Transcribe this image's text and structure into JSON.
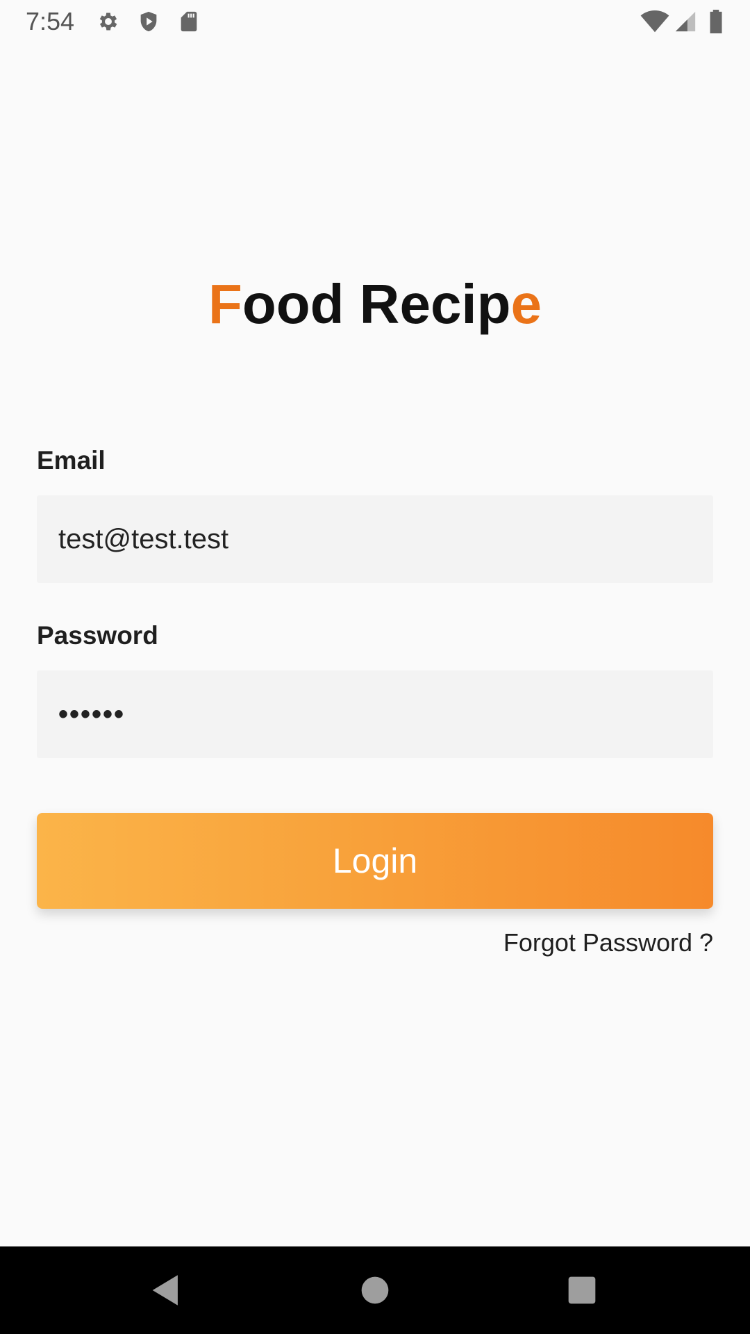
{
  "status_bar": {
    "time": "7:54",
    "icons_left": [
      "settings-gear-icon",
      "play-protect-icon",
      "sd-card-icon"
    ],
    "icons_right": [
      "wifi-icon",
      "cell-signal-icon",
      "battery-icon"
    ]
  },
  "app": {
    "title_first": "F",
    "title_middle": "ood Recip",
    "title_last": "e",
    "accent_color": "#ea7318"
  },
  "form": {
    "email_label": "Email",
    "email_value": "test@test.test",
    "password_label": "Password",
    "password_value": "••••••",
    "login_label": "Login",
    "forgot_label": "Forgot Password ?"
  },
  "colors": {
    "button_gradient_start": "#fbb449",
    "button_gradient_end": "#f68a2b",
    "input_background": "#f3f3f3",
    "page_background": "#fafafa"
  },
  "nav_bar": {
    "buttons": [
      "back-icon",
      "home-icon",
      "recents-icon"
    ]
  }
}
